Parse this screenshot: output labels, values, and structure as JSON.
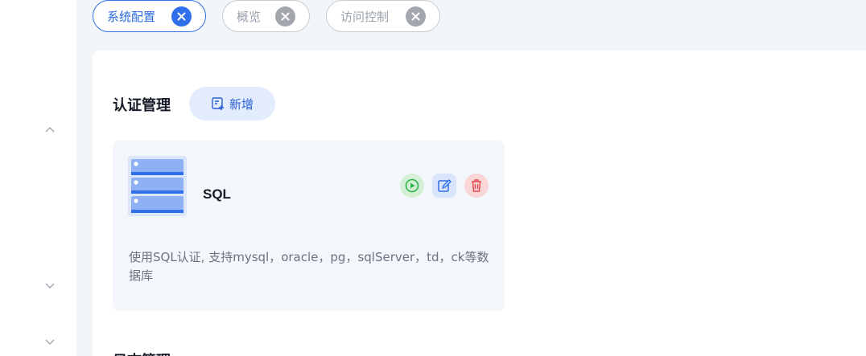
{
  "sidebar": {
    "chevrons": [
      {
        "icon": "chevron-up-icon"
      },
      {
        "icon": "chevron-down-icon"
      },
      {
        "icon": "chevron-down-icon"
      }
    ]
  },
  "tabs": [
    {
      "label": "系统配置",
      "active": true,
      "close_icon": "close-circle-icon"
    },
    {
      "label": "概览",
      "active": false,
      "close_icon": "close-circle-icon"
    },
    {
      "label": "访问控制",
      "active": false,
      "close_icon": "close-circle-icon"
    }
  ],
  "auth_section": {
    "title": "认证管理",
    "add_label": "新增",
    "add_icon": "add-document-icon",
    "cards": [
      {
        "name": "SQL",
        "icon": "database-icon",
        "description": "使用SQL认证, 支持mysql，oracle，pg，sqlServer，td，ck等数据库",
        "actions": [
          "play-icon",
          "edit-icon",
          "trash-icon"
        ]
      }
    ]
  },
  "next_section": {
    "title": "日志管理"
  },
  "colors": {
    "accent": "#2f6fea",
    "run": "#2fb34a",
    "delete": "#e5484d"
  }
}
